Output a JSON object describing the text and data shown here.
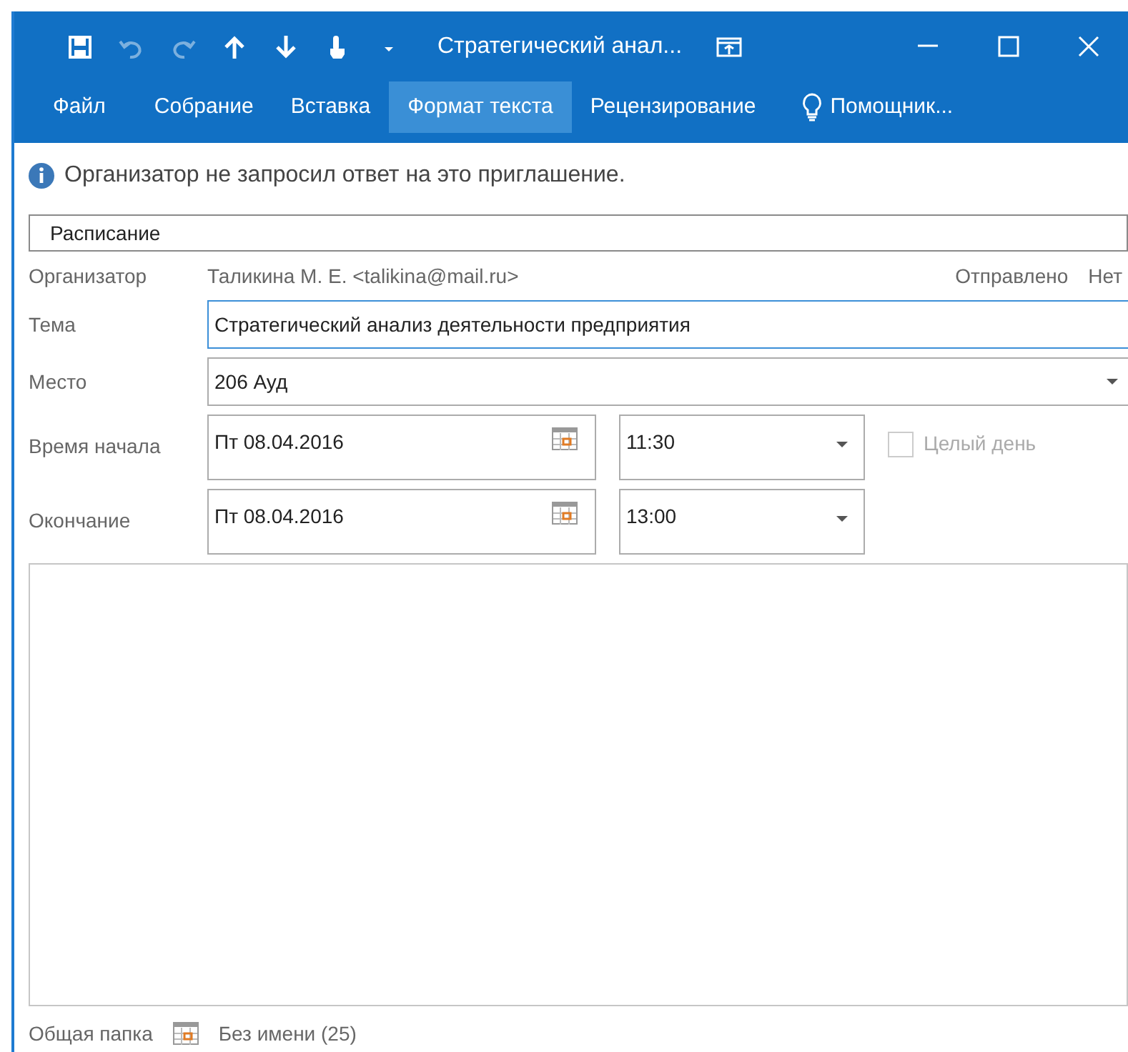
{
  "window": {
    "title": "Стратегический анал..."
  },
  "quick_access": [
    {
      "kind": "save",
      "disabled": false
    },
    {
      "kind": "undo",
      "disabled": true
    },
    {
      "kind": "redo",
      "disabled": true
    },
    {
      "kind": "up",
      "disabled": false
    },
    {
      "kind": "down",
      "disabled": false
    },
    {
      "kind": "touch",
      "disabled": false
    },
    {
      "kind": "customize",
      "disabled": false
    }
  ],
  "tabs": [
    {
      "label": "Файл",
      "selected": false,
      "kind": "file"
    },
    {
      "label": "Собрание",
      "selected": false,
      "kind": "tab"
    },
    {
      "label": "Вставка",
      "selected": false,
      "kind": "tab"
    },
    {
      "label": "Формат текста",
      "selected": true,
      "kind": "tab"
    },
    {
      "label": "Рецензирование",
      "selected": false,
      "kind": "tab"
    },
    {
      "label": "Помощник...",
      "selected": false,
      "kind": "tellme"
    }
  ],
  "info_bar": {
    "text": "Организатор не запросил ответ на это приглашение."
  },
  "scheduling_button": {
    "label": "Расписание"
  },
  "organizer": {
    "label": "Организатор",
    "value": "Таликина М. Е. <talikina@mail.ru>",
    "sent_label": "Отправлено",
    "sent_value": "Нет"
  },
  "subject": {
    "label": "Тема",
    "value": "Стратегический анализ деятельности предприятия",
    "focused": true
  },
  "location": {
    "label": "Место",
    "value": "206 Ауд"
  },
  "start": {
    "label": "Время начала",
    "date": "Пт 08.04.2016",
    "time": "11:30"
  },
  "end": {
    "label": "Окончание",
    "date": "Пт 08.04.2016",
    "time": "13:00"
  },
  "all_day": {
    "label": "Целый день",
    "checked": false,
    "disabled": true
  },
  "footer": {
    "folder_label": "Общая папка",
    "calendar_name": "Без имени (25)"
  }
}
